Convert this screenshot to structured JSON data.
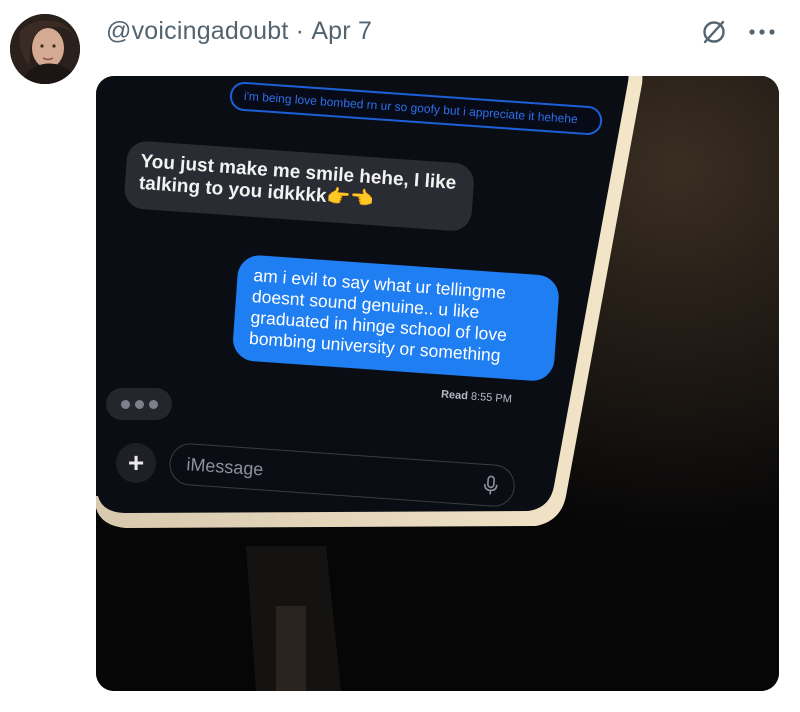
{
  "tweet": {
    "handle": "@voicingadoubt",
    "separator": "·",
    "date": "Apr 7",
    "avatar_icon": "avatar",
    "grok_icon": "grok-icon",
    "more_icon": "more-icon"
  },
  "photo": {
    "messages": {
      "top_sent": "i'm being love bombed rn ur so goofy but i appreciate it hehehe",
      "received": "You just make me smile hehe, I like talking to you idkkkk👉👈",
      "sent": "am i evil to say what ur tellingme doesnt sound genuine.. u like graduated in hinge school of love bombing university or something",
      "read_label": "Read",
      "read_time": "8:55 PM"
    },
    "input": {
      "placeholder": "iMessage",
      "plus_label": "+"
    },
    "colors": {
      "sent_bubble": "#1f7ef2",
      "received_bubble": "#2a2c33"
    }
  }
}
